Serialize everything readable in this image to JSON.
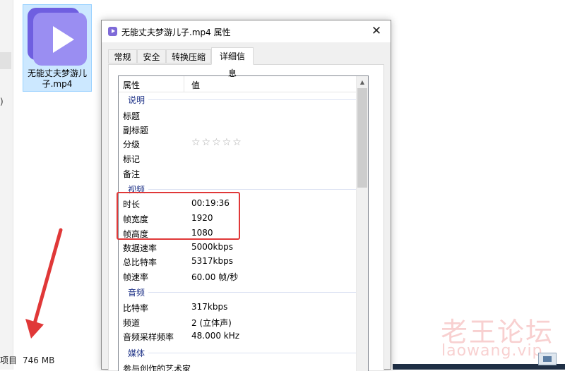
{
  "background": {
    "left_paren": ")",
    "file_tile": {
      "name_line1": "无能丈夫梦游儿",
      "name_line2": "子.mp4",
      "thumb_icon": "play-icon",
      "thumb_color": "#8c7ef0"
    },
    "status_bar": {
      "label": "项目",
      "size": "746 MB"
    },
    "watermark": {
      "text": "老王论坛",
      "url": "laowang.vip"
    },
    "annotation_color": "#e03838"
  },
  "dialog": {
    "title": "无能丈夫梦游儿子.mp4 属性",
    "close_glyph": "✕",
    "tabs": [
      {
        "label": "常规"
      },
      {
        "label": "安全"
      },
      {
        "label": "转换压缩"
      },
      {
        "label": "详细信息"
      }
    ],
    "columns": {
      "property": "属性",
      "value": "值"
    },
    "groups": {
      "description": "说明",
      "video": "视频",
      "audio": "音频",
      "media": "媒体"
    },
    "rows": {
      "title": {
        "name": "标题",
        "value": ""
      },
      "subtitle": {
        "name": "副标题",
        "value": ""
      },
      "rating": {
        "name": "分级",
        "stars": "☆☆☆☆☆"
      },
      "tags": {
        "name": "标记",
        "value": ""
      },
      "comments": {
        "name": "备注",
        "value": ""
      },
      "duration": {
        "name": "时长",
        "value": "00:19:36"
      },
      "frame_width": {
        "name": "帧宽度",
        "value": "1920"
      },
      "frame_height": {
        "name": "帧高度",
        "value": "1080"
      },
      "data_rate": {
        "name": "数据速率",
        "value": "5000kbps"
      },
      "total_bitrate": {
        "name": "总比特率",
        "value": "5317kbps"
      },
      "frame_rate": {
        "name": "帧速率",
        "value": "60.00 帧/秒"
      },
      "bitrate": {
        "name": "比特率",
        "value": "317kbps"
      },
      "channels": {
        "name": "频道",
        "value": "2 (立体声)"
      },
      "sample_rate": {
        "name": "音频采样频率",
        "value": "48.000 kHz"
      },
      "contributing_artists": {
        "name": "参与创作的艺术家",
        "value": ""
      }
    }
  }
}
